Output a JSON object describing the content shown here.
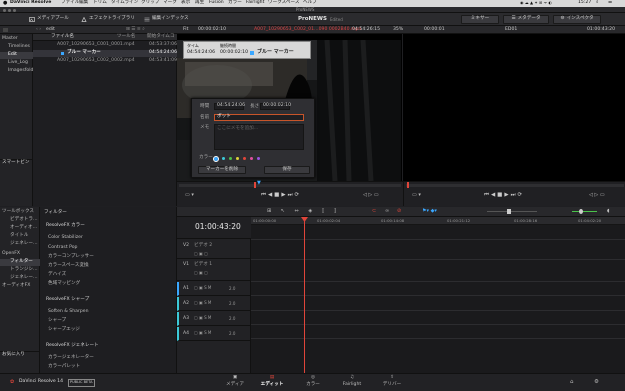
{
  "menubar": {
    "app": "DaVinci Resolve",
    "items": [
      "ファイル",
      "編集",
      "トリム",
      "タイムライン",
      "クリップ",
      "マーク",
      "表示",
      "再生",
      "Fusion",
      "カラー",
      "Fairlight",
      "ワークスペース",
      "ヘルプ"
    ],
    "clock": "15:27"
  },
  "window": {
    "title": "ProNEWS"
  },
  "toolbar": {
    "media_pool": "メディアプール",
    "effects_library": "エフェクトライブラリ",
    "edit_index": "編集インデックス",
    "project": "ProNEWS",
    "edited": "Edited",
    "mixer": "ミキサー",
    "metadata": "メタデータ",
    "inspector": "インスペクタ"
  },
  "viewer_header": {
    "fit": "Fit",
    "src_tc": "00:00:02:10",
    "clip_name": "A007_10290653_C002_01…090 0002B40.mp4",
    "dur_tc": "04:54:26:15",
    "zoom": "35%",
    "tl_tc": "00:00:01",
    "timeline_name": "ED01",
    "tl_tc2": "01:00:43:20"
  },
  "bins": {
    "master": "Master",
    "items": [
      "Timelines",
      "Edit",
      "Live_Log",
      "Imagesfolds"
    ],
    "smart_bins": "スマートビン"
  },
  "media": {
    "bin_name": "edit",
    "columns": [
      "ファイル名",
      "ツール名",
      "開始タイムコ"
    ],
    "rows": [
      {
        "name": "A007_10290653_C001_0001.mp4",
        "tc": "04:53:37:06"
      },
      {
        "name": "ブルー マーカー",
        "tc": "04:54:24:06"
      },
      {
        "name": "A007_10290653_C002_0002.mp4",
        "tc": "04:53:41:09"
      }
    ]
  },
  "marker_tooltip": {
    "col1": "タイム",
    "col2": "継続時間",
    "time": "04:54:24:06",
    "duration": "00:00:02:10",
    "name": "ブルー マーカー"
  },
  "marker_dialog": {
    "time_label": "時間",
    "time_value": "04:54:24:06",
    "dur_label": "長さ",
    "dur_value": "00:00:02:10",
    "name_label": "名前",
    "name_value": "ボット",
    "memo_label": "メモ",
    "memo_placeholder": "ここにメモを追加...",
    "color_label": "カラー",
    "colors": [
      "#3aa7ff",
      "#3cc9d8",
      "#4ac24a",
      "#e0d23a",
      "#e69a2a",
      "#e0453a",
      "#e04fa0",
      "#9a55e0"
    ],
    "delete_button": "マーカーを削除",
    "save_button": "保存"
  },
  "effects": {
    "toolbox": "ツールボックス",
    "items": [
      "ビデオトラ…",
      "オーディオ…",
      "タイトル",
      "ジェネレー…"
    ],
    "openfx": "OpenFX",
    "fx_selected": "フィルター",
    "fx_items": [
      "トランジシ…",
      "ジェネレー…"
    ],
    "audio_fx": "オーディオFX",
    "favorites": "お気に入り"
  },
  "filters": {
    "header": "フィルター",
    "groups": [
      {
        "title": "ResolveFX カラー",
        "items": [
          "Color Stabilizer",
          "Contrast Pop",
          "カラーコンプレッサー",
          "カラースペース変換",
          "デハイズ",
          "色域マッピング"
        ]
      },
      {
        "title": "ResolveFX シャープ",
        "items": [
          "Soften & Sharpen",
          "シャープ",
          "シャープエッジ"
        ]
      },
      {
        "title": "ResolveFX ジェネレート",
        "items": [
          "カラージェネレーター",
          "カラーパレット"
        ]
      }
    ]
  },
  "timeline": {
    "timecode": "01:00:43:20",
    "ruler": [
      "01:00:00:00",
      "01:00:02:04",
      "01:00:14:08",
      "01:00:21:12",
      "01:00:28:16",
      "01:04:02:20"
    ],
    "tracks": [
      {
        "id": "V2",
        "name": "ビデオ 2"
      },
      {
        "id": "V1",
        "name": "ビデオ 1"
      },
      {
        "id": "A1",
        "level": "2.0"
      },
      {
        "id": "A2",
        "level": "2.0"
      },
      {
        "id": "A3",
        "level": "2.0"
      },
      {
        "id": "A4",
        "level": "2.0"
      }
    ]
  },
  "pagebar": {
    "app": "DaVinci Resolve 14",
    "beta": "PUBLIC BETA",
    "pages": [
      "メディア",
      "エディット",
      "カラー",
      "Fairlight",
      "デリバー"
    ]
  },
  "accent": "#e0453a"
}
